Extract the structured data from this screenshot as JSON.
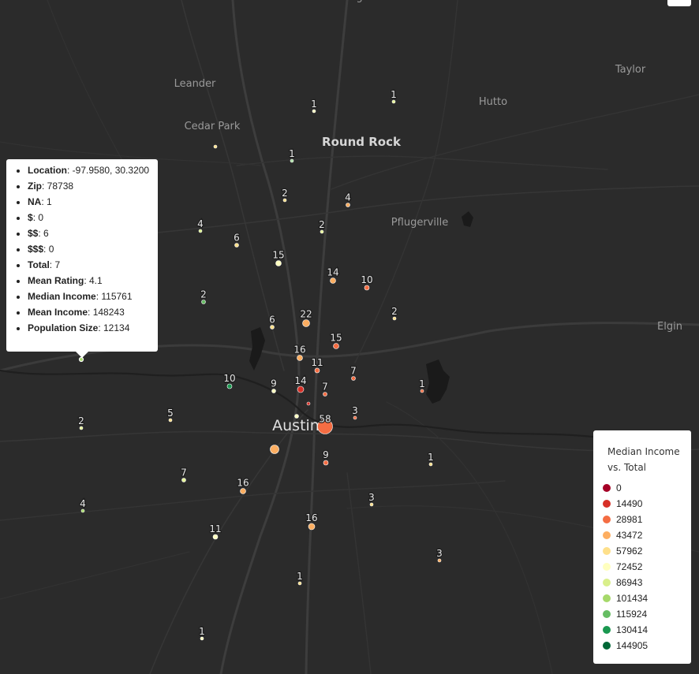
{
  "places": [
    {
      "name": "Georgetown",
      "cls": "place"
    },
    {
      "name": "Leander",
      "cls": "place"
    },
    {
      "name": "Cedar Park",
      "cls": "place"
    },
    {
      "name": "Round Rock",
      "cls": "place place-major"
    },
    {
      "name": "Hutto",
      "cls": "place"
    },
    {
      "name": "Taylor",
      "cls": "place"
    },
    {
      "name": "Pflugerville",
      "cls": "place"
    },
    {
      "name": "Elgin",
      "cls": "place"
    },
    {
      "name": "Austin",
      "cls": "place place-city"
    }
  ],
  "markers": [
    {
      "label": "1",
      "color": "#e6f598"
    },
    {
      "label": "1",
      "color": "#ffffbf"
    },
    {
      "label": "",
      "color": "#fee08b"
    },
    {
      "label": "1",
      "color": "#abdda4"
    },
    {
      "label": "2",
      "color": "#fee08b"
    },
    {
      "label": "4",
      "color": "#fdae61"
    },
    {
      "label": "2",
      "color": "#e6f598"
    },
    {
      "label": "4",
      "color": "#d9ef8b"
    },
    {
      "label": "6",
      "color": "#fee08b"
    },
    {
      "label": "15",
      "color": "#ffffbf"
    },
    {
      "label": "14",
      "color": "#fdae61"
    },
    {
      "label": "10",
      "color": "#f46d43"
    },
    {
      "label": "2",
      "color": "#66bd63"
    },
    {
      "label": "2",
      "color": "#fee08b"
    },
    {
      "label": "6",
      "color": "#fee08b"
    },
    {
      "label": "22",
      "color": "#fdae61"
    },
    {
      "label": "15",
      "color": "#f46d43"
    },
    {
      "label": "16",
      "color": "#fdae61"
    },
    {
      "label": "11",
      "color": "#f46d43"
    },
    {
      "label": "7",
      "color": "#f46d43"
    },
    {
      "label": "10",
      "color": "#1a9850"
    },
    {
      "label": "9",
      "color": "#ffffbf"
    },
    {
      "label": "14",
      "color": "#d73027"
    },
    {
      "label": "7",
      "color": "#f46d43"
    },
    {
      "label": "1",
      "color": "#f46d43"
    },
    {
      "label": "",
      "color": "#d73027"
    },
    {
      "label": "3",
      "color": "#f46d43"
    },
    {
      "label": "",
      "color": "#ffffbf"
    },
    {
      "label": "58",
      "color": "#f46d43"
    },
    {
      "label": "",
      "color": "#fdae61"
    },
    {
      "label": "9",
      "color": "#f46d43"
    },
    {
      "label": "1",
      "color": "#fee08b"
    },
    {
      "label": "2",
      "color": "#e6f598"
    },
    {
      "label": "5",
      "color": "#fee08b"
    },
    {
      "label": "7",
      "color": "#e6f598"
    },
    {
      "label": "16",
      "color": "#fdae61"
    },
    {
      "label": "3",
      "color": "#fee08b"
    },
    {
      "label": "4",
      "color": "#a6d96a"
    },
    {
      "label": "11",
      "color": "#ffffbf"
    },
    {
      "label": "16",
      "color": "#fdae61"
    },
    {
      "label": "3",
      "color": "#fdae61"
    },
    {
      "label": "1",
      "color": "#fee08b"
    },
    {
      "label": "1",
      "color": "#ffffbf"
    },
    {
      "label": "",
      "color": "#a6d96a"
    }
  ],
  "tooltip": {
    "rows": [
      {
        "key": "Location",
        "value": "-97.9580, 30.3200"
      },
      {
        "key": "Zip",
        "value": "78738"
      },
      {
        "key": "NA",
        "value": "1"
      },
      {
        "key": "$",
        "value": "0"
      },
      {
        "key": "$$",
        "value": "6"
      },
      {
        "key": "$$$",
        "value": "0"
      },
      {
        "key": "Total",
        "value": "7"
      },
      {
        "key": "Mean Rating",
        "value": "4.1"
      },
      {
        "key": "Median Income",
        "value": "115761"
      },
      {
        "key": "Mean Income",
        "value": "148243"
      },
      {
        "key": "Population Size",
        "value": "12134"
      }
    ]
  },
  "legend": {
    "title_line1": "Median Income",
    "title_line2": "vs. Total",
    "items": [
      {
        "label": "0",
        "color": "#a50026"
      },
      {
        "label": "14490",
        "color": "#d73027"
      },
      {
        "label": "28981",
        "color": "#f46d43"
      },
      {
        "label": "43472",
        "color": "#fdae61"
      },
      {
        "label": "57962",
        "color": "#fee08b"
      },
      {
        "label": "72452",
        "color": "#ffffbf"
      },
      {
        "label": "86943",
        "color": "#d9ef8b"
      },
      {
        "label": "101434",
        "color": "#a6d96a"
      },
      {
        "label": "115924",
        "color": "#66bd63"
      },
      {
        "label": "130414",
        "color": "#1a9850"
      },
      {
        "label": "144905",
        "color": "#006837"
      }
    ]
  }
}
